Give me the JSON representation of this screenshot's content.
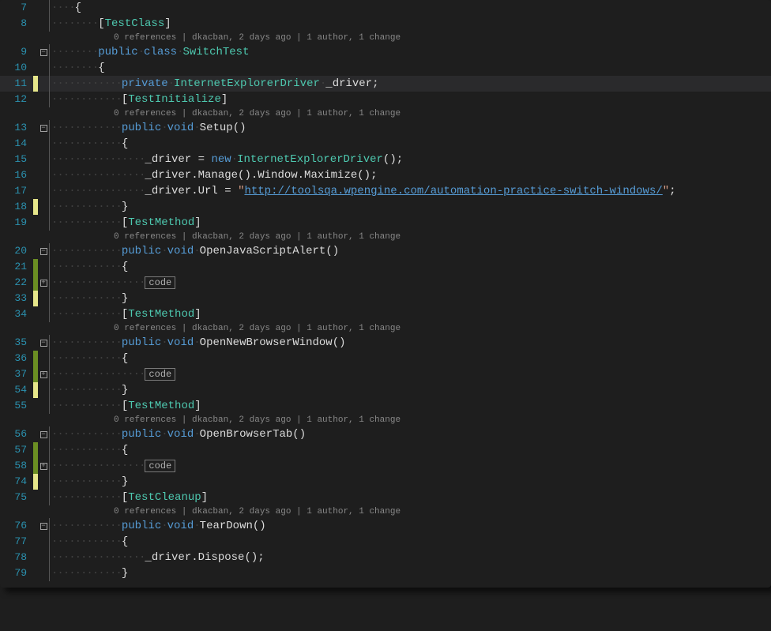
{
  "codelens_text": "0 references | dkacban, 2 days ago | 1 author, 1 change",
  "fold_minus": "−",
  "fold_plus": "+",
  "codebox_label": "code",
  "lines": {
    "l7": {
      "num": "7"
    },
    "l8": {
      "num": "8",
      "attr": "TestClass"
    },
    "l9": {
      "num": "9",
      "kw1": "public",
      "kw2": "class",
      "name": "SwitchTest"
    },
    "l10": {
      "num": "10"
    },
    "l11": {
      "num": "11",
      "kw": "private",
      "type": "InternetExplorerDriver",
      "field": "_driver"
    },
    "l12": {
      "num": "12",
      "attr": "TestInitialize"
    },
    "l13": {
      "num": "13",
      "kw1": "public",
      "kw2": "void",
      "name": "Setup"
    },
    "l14": {
      "num": "14"
    },
    "l15": {
      "num": "15",
      "lhs": "_driver",
      "kw": "new",
      "type": "InternetExplorerDriver"
    },
    "l16": {
      "num": "16",
      "text": "_driver.Manage().Window.Maximize();"
    },
    "l17": {
      "num": "17",
      "lhs": "_driver.Url",
      "url": "http://toolsqa.wpengine.com/automation-practice-switch-windows/"
    },
    "l18": {
      "num": "18"
    },
    "l19": {
      "num": "19",
      "attr": "TestMethod"
    },
    "l20": {
      "num": "20",
      "kw1": "public",
      "kw2": "void",
      "name": "OpenJavaScriptAlert"
    },
    "l21": {
      "num": "21"
    },
    "l22": {
      "num": "22"
    },
    "l33": {
      "num": "33"
    },
    "l34": {
      "num": "34",
      "attr": "TestMethod"
    },
    "l35": {
      "num": "35",
      "kw1": "public",
      "kw2": "void",
      "name": "OpenNewBrowserWindow"
    },
    "l36": {
      "num": "36"
    },
    "l37": {
      "num": "37"
    },
    "l54": {
      "num": "54"
    },
    "l55": {
      "num": "55",
      "attr": "TestMethod"
    },
    "l56": {
      "num": "56",
      "kw1": "public",
      "kw2": "void",
      "name": "OpenBrowserTab"
    },
    "l57": {
      "num": "57"
    },
    "l58": {
      "num": "58"
    },
    "l74": {
      "num": "74"
    },
    "l75": {
      "num": "75",
      "attr": "TestCleanup"
    },
    "l76": {
      "num": "76",
      "kw1": "public",
      "kw2": "void",
      "name": "TearDown"
    },
    "l77": {
      "num": "77"
    },
    "l78": {
      "num": "78",
      "text": "_driver.Dispose();"
    },
    "l79": {
      "num": "79"
    }
  }
}
